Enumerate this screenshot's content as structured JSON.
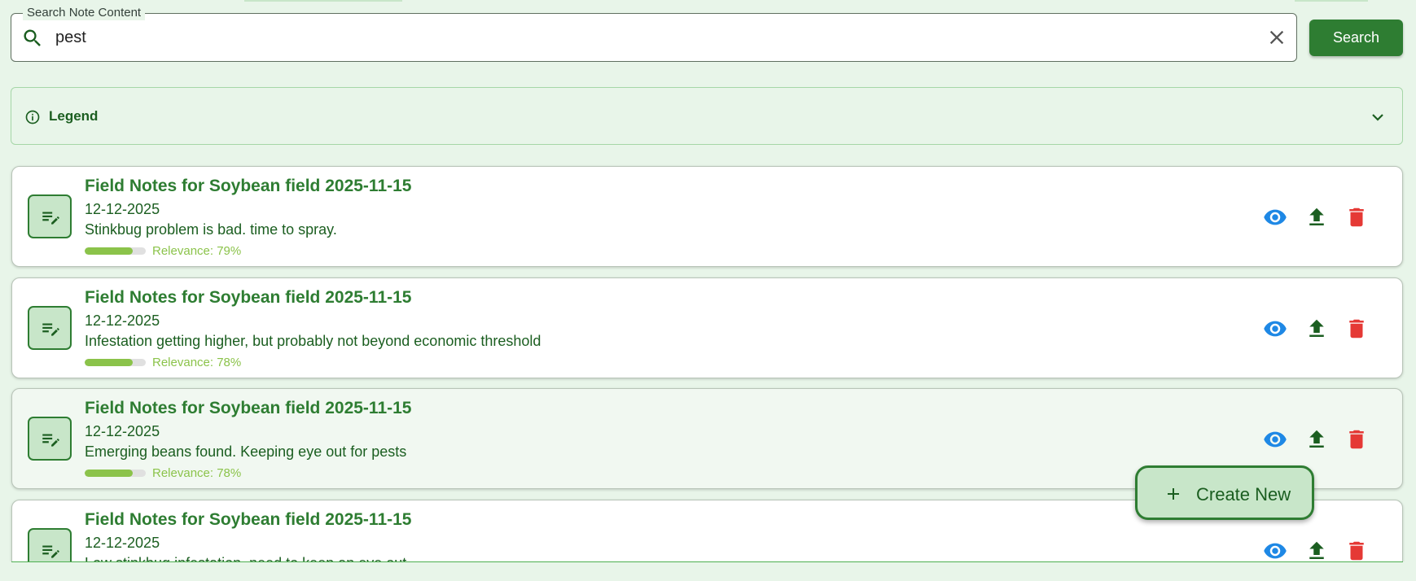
{
  "search": {
    "label": "Search Note Content",
    "value": "pest",
    "button_label": "Search"
  },
  "legend": {
    "title": "Legend"
  },
  "notes": [
    {
      "title": "Field Notes for Soybean field 2025-11-15",
      "date": "12-12-2025",
      "text": "Stinkbug problem is bad. time to spray.",
      "relevance_label": "Relevance: 79%",
      "relevance": 0.79
    },
    {
      "title": "Field Notes for Soybean field 2025-11-15",
      "date": "12-12-2025",
      "text": "Infestation getting higher, but probably not beyond economic threshold",
      "relevance_label": "Relevance: 78%",
      "relevance": 0.78
    },
    {
      "title": "Field Notes for Soybean field 2025-11-15",
      "date": "12-12-2025",
      "text": "Emerging beans found. Keeping eye out for pests",
      "relevance_label": "Relevance: 78%",
      "relevance": 0.78
    },
    {
      "title": "Field Notes for Soybean field 2025-11-15",
      "date": "12-12-2025",
      "text": "Low stinkbug infestation, need to keep an eye out",
      "relevance_label": "",
      "relevance": null
    }
  ],
  "fab": {
    "label": "Create New"
  },
  "colors": {
    "primary": "#2e7d32",
    "view_icon": "#1e88e5",
    "upload_icon": "#1b5e20",
    "delete_icon": "#e53935",
    "relevance": "#8bc34a"
  }
}
